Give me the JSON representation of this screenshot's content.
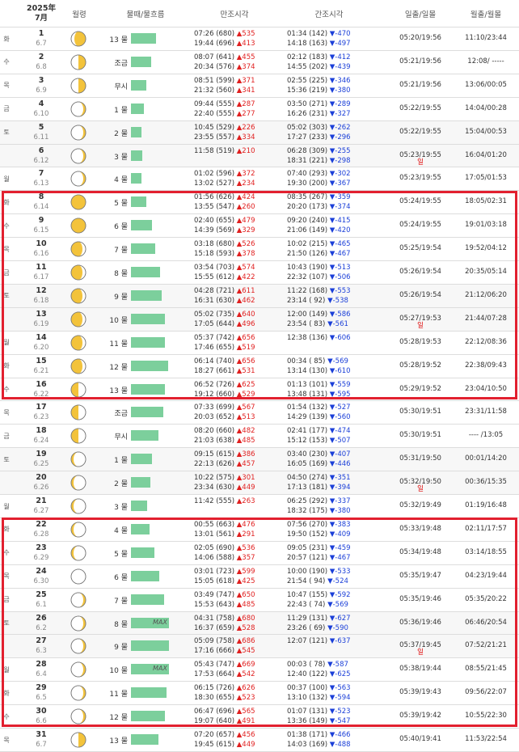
{
  "header": {
    "year_month_line1": "2025年",
    "year_month_line2": "7月",
    "moon_phase": "월령",
    "tide_flow": "물때/물흐름",
    "high_tide": "만조시각",
    "low_tide": "간조시각",
    "sunrise_sunset": "일출/일몰",
    "moonrise_moonset": "월출/월몰"
  },
  "colors": {
    "bar": "#7ccf9c",
    "up": "#e02020",
    "down": "#1b3fd8",
    "highlight_box": "#e2202f"
  },
  "rows": [
    {
      "dow": "화",
      "d": "1",
      "lunar": "6.7",
      "moon": "waxing-gibbous",
      "tide": "13 물",
      "bar": 0.52,
      "max": "",
      "h1": "07:26 (680) ",
      "h1d": "▲535",
      "h2": "19:44 (696) ",
      "h2d": "▲413",
      "l1": "01:34 (142) ",
      "l1d": "▼-470",
      "l2": "14:18 (163) ",
      "l2d": "▼-497",
      "sun": "05:20/19:56",
      "moonrs": "11:10/23:44"
    },
    {
      "dow": "수",
      "d": "2",
      "lunar": "6.8",
      "moon": "first-quarter",
      "tide": "조금",
      "bar": 0.42,
      "max": "",
      "h1": "08:07 (641) ",
      "h1d": "▲455",
      "h2": "20:34 (576) ",
      "h2d": "▲374",
      "l1": "02:12 (183) ",
      "l1d": "▼-412",
      "l2": "14:55 (202) ",
      "l2d": "▼-439",
      "sun": "05:21/19:56",
      "moonrs": "12:08/  -----"
    },
    {
      "dow": "목",
      "d": "3",
      "lunar": "6.9",
      "moon": "first-quarter",
      "tide": "무시",
      "bar": 0.32,
      "max": "",
      "h1": "08:51 (599) ",
      "h1d": "▲371",
      "h2": "21:32 (560) ",
      "h2d": "▲341",
      "l1": "02:55 (225) ",
      "l1d": "▼-346",
      "l2": "15:36 (219) ",
      "l2d": "▼-380",
      "sun": "05:21/19:56",
      "moonrs": "13:06/00:05"
    },
    {
      "dow": "금",
      "d": "4",
      "lunar": "6.10",
      "moon": "waxing-crescent",
      "tide": "1 물",
      "bar": 0.26,
      "max": "",
      "h1": "09:44 (555) ",
      "h1d": "▲287",
      "h2": "22:40 (555) ",
      "h2d": "▲277",
      "l1": "03:50 (271) ",
      "l1d": "▼-289",
      "l2": "16:26 (231) ",
      "l2d": "▼-327",
      "sun": "05:22/19:55",
      "moonrs": "14:04/00:28"
    },
    {
      "dow": "토",
      "d": "5",
      "lunar": "6.11",
      "moon": "waxing-crescent",
      "tide": "2 물",
      "bar": 0.22,
      "max": "",
      "h1": "10:45 (529) ",
      "h1d": "▲226",
      "h2": "23:55 (557) ",
      "h2d": "▲334",
      "l1": "05:02 (303) ",
      "l1d": "▼-262",
      "l2": "17:27 (233) ",
      "l2d": "▼-296",
      "sun": "05:22/19:55",
      "moonrs": "15:04/00:53"
    },
    {
      "dow": "일",
      "d": "6",
      "lunar": "6.12",
      "moon": "waxing-crescent",
      "tide": "3 물",
      "bar": 0.23,
      "max": "",
      "h1": "11:58 (519) ",
      "h1d": "▲210",
      "h2": "",
      "h2d": "",
      "l1": "06:28 (309) ",
      "l1d": "▼-255",
      "l2": "18:31 (221) ",
      "l2d": "▼-298",
      "sun": "05:23/19:55",
      "moonrs": "16:04/01:20"
    },
    {
      "dow": "월",
      "d": "7",
      "lunar": "6.13",
      "moon": "waxing-crescent",
      "tide": "4 물",
      "bar": 0.22,
      "max": "",
      "h1": "01:02 (596) ",
      "h1d": "▲372",
      "h2": "13:02 (527) ",
      "h2d": "▲234",
      "l1": "07:40 (293) ",
      "l1d": "▼-302",
      "l2": "19:30 (200) ",
      "l2d": "▼-367",
      "sun": "05:23/19:55",
      "moonrs": "17:05/01:53"
    },
    {
      "dow": "화",
      "d": "8",
      "lunar": "6.14",
      "moon": "full",
      "tide": "5 물",
      "bar": 0.32,
      "max": "",
      "h1": "01:56 (626) ",
      "h1d": "▲424",
      "h2": "13:55 (547) ",
      "h2d": "▲260",
      "l1": "08:35 (267) ",
      "l1d": "▼-359",
      "l2": "20:20 (173) ",
      "l2d": "▼-374",
      "sun": "05:24/19:55",
      "moonrs": "18:05/02:31"
    },
    {
      "dow": "수",
      "d": "9",
      "lunar": "6.15",
      "moon": "full",
      "tide": "6 물",
      "bar": 0.44,
      "max": "",
      "h1": "02:40 (655) ",
      "h1d": "▲479",
      "h2": "14:39 (569) ",
      "h2d": "▲329",
      "l1": "09:20 (240) ",
      "l1d": "▼-415",
      "l2": "21:06 (149) ",
      "l2d": "▼-420",
      "sun": "05:24/19:55",
      "moonrs": "19:01/03:18"
    },
    {
      "dow": "목",
      "d": "10",
      "lunar": "6.16",
      "moon": "waning-gibbous",
      "tide": "7 물",
      "bar": 0.5,
      "max": "",
      "h1": "03:18 (680) ",
      "h1d": "▲526",
      "h2": "15:18 (593) ",
      "h2d": "▲378",
      "l1": "10:02 (215) ",
      "l1d": "▼-465",
      "l2": "21:50 (126) ",
      "l2d": "▼-467",
      "sun": "05:25/19:54",
      "moonrs": "19:52/04:12"
    },
    {
      "dow": "금",
      "d": "11",
      "lunar": "6.17",
      "moon": "waning-gibbous",
      "tide": "8 물",
      "bar": 0.6,
      "max": "",
      "h1": "03:54 (703) ",
      "h1d": "▲574",
      "h2": "15:55 (612) ",
      "h2d": "▲422",
      "l1": "10:43 (190) ",
      "l1d": "▼-513",
      "l2": "22:32 (107) ",
      "l2d": "▼-506",
      "sun": "05:26/19:54",
      "moonrs": "20:35/05:14"
    },
    {
      "dow": "토",
      "d": "12",
      "lunar": "6.18",
      "moon": "waning-gibbous",
      "tide": "9 물",
      "bar": 0.64,
      "max": "",
      "h1": "04:28 (721) ",
      "h1d": "▲611",
      "h2": "16:31 (630) ",
      "h2d": "▲462",
      "l1": "11:22 (168) ",
      "l1d": "▼-553",
      "l2": "23:14 ( 92) ",
      "l2d": "▼-538",
      "sun": "05:26/19:54",
      "moonrs": "21:12/06:20"
    },
    {
      "dow": "일",
      "d": "13",
      "lunar": "6.19",
      "moon": "waning-gibbous",
      "tide": "10 물",
      "bar": 0.7,
      "max": "",
      "h1": "05:02 (735) ",
      "h1d": "▲640",
      "h2": "17:05 (644) ",
      "h2d": "▲496",
      "l1": "12:00 (149) ",
      "l1d": "▼-586",
      "l2": "23:54 ( 83) ",
      "l2d": "▼-561",
      "sun": "05:27/19:53",
      "moonrs": "21:44/07:28"
    },
    {
      "dow": "월",
      "d": "14",
      "lunar": "6.20",
      "moon": "waning-gibbous",
      "tide": "11 물",
      "bar": 0.7,
      "max": "",
      "h1": "05:37 (742) ",
      "h1d": "▲656",
      "h2": "17:46 (655) ",
      "h2d": "▲519",
      "l1": "12:38 (136) ",
      "l1d": "▼-606",
      "l2": "",
      "l2d": "",
      "sun": "05:28/19:53",
      "moonrs": "22:12/08:36"
    },
    {
      "dow": "화",
      "d": "15",
      "lunar": "6.21",
      "moon": "waning-gibbous",
      "tide": "12 물",
      "bar": 0.76,
      "max": "",
      "h1": "06:14 (740) ",
      "h1d": "▲656",
      "h2": "18:27 (661) ",
      "h2d": "▲531",
      "l1": "00:34 ( 85) ",
      "l1d": "▼-569",
      "l2": "13:14 (130) ",
      "l2d": "▼-610",
      "sun": "05:28/19:52",
      "moonrs": "22:38/09:43"
    },
    {
      "dow": "수",
      "d": "16",
      "lunar": "6.22",
      "moon": "third-quarter",
      "tide": "13 물",
      "bar": 0.7,
      "max": "",
      "h1": "06:52 (726) ",
      "h1d": "▲625",
      "h2": "19:12 (660) ",
      "h2d": "▲529",
      "l1": "01:13 (101) ",
      "l1d": "▼-559",
      "l2": "13:48 (131) ",
      "l2d": "▼-595",
      "sun": "05:29/19:52",
      "moonrs": "23:04/10:50"
    },
    {
      "dow": "목",
      "d": "17",
      "lunar": "6.23",
      "moon": "third-quarter",
      "tide": "조금",
      "bar": 0.66,
      "max": "",
      "h1": "07:33 (699) ",
      "h1d": "▲567",
      "h2": "20:03 (652) ",
      "h2d": "▲513",
      "l1": "01:54 (132) ",
      "l1d": "▼-527",
      "l2": "14:29 (139) ",
      "l2d": "▼-560",
      "sun": "05:30/19:51",
      "moonrs": "23:31/11:58"
    },
    {
      "dow": "금",
      "d": "18",
      "lunar": "6.24",
      "moon": "third-quarter",
      "tide": "무시",
      "bar": 0.56,
      "max": "",
      "h1": "08:20 (660) ",
      "h1d": "▲482",
      "h2": "21:03 (638) ",
      "h2d": "▲485",
      "l1": "02:41 (177) ",
      "l1d": "▼-474",
      "l2": "15:12 (153) ",
      "l2d": "▼-507",
      "sun": "05:30/19:51",
      "moonrs": "----  /13:05"
    },
    {
      "dow": "토",
      "d": "19",
      "lunar": "6.25",
      "moon": "waning-crescent",
      "tide": "1 물",
      "bar": 0.44,
      "max": "",
      "h1": "09:15 (615) ",
      "h1d": "▲386",
      "h2": "22:13 (626) ",
      "h2d": "▲457",
      "l1": "03:40 (230) ",
      "l1d": "▼-407",
      "l2": "16:05 (169) ",
      "l2d": "▼-446",
      "sun": "05:31/19:50",
      "moonrs": "00:01/14:20"
    },
    {
      "dow": "일",
      "d": "20",
      "lunar": "6.26",
      "moon": "waning-crescent",
      "tide": "2 물",
      "bar": 0.4,
      "max": "",
      "h1": "10:22 (575) ",
      "h1d": "▲301",
      "h2": "23:34 (630) ",
      "h2d": "▲449",
      "l1": "04:50 (274) ",
      "l1d": "▼-351",
      "l2": "17:13 (181) ",
      "l2d": "▼-394",
      "sun": "05:32/19:50",
      "moonrs": "00:36/15:35"
    },
    {
      "dow": "월",
      "d": "21",
      "lunar": "6.27",
      "moon": "waning-crescent",
      "tide": "3 물",
      "bar": 0.34,
      "max": "",
      "h1": "11:42 (555) ",
      "h1d": "▲263",
      "h2": "",
      "h2d": "",
      "l1": "06:25 (292) ",
      "l1d": "▼-337",
      "l2": "18:32 (175) ",
      "l2d": "▼-380",
      "sun": "05:32/19:49",
      "moonrs": "01:19/16:48"
    },
    {
      "dow": "화",
      "d": "22",
      "lunar": "6.28",
      "moon": "waning-crescent",
      "tide": "4 물",
      "bar": 0.38,
      "max": "",
      "h1": "00:55 (663) ",
      "h1d": "▲476",
      "h2": "13:01 (561) ",
      "h2d": "▲291",
      "l1": "07:56 (270) ",
      "l1d": "▼-383",
      "l2": "19:50 (152) ",
      "l2d": "▼-409",
      "sun": "05:33/19:48",
      "moonrs": "02:11/17:57"
    },
    {
      "dow": "수",
      "d": "23",
      "lunar": "6.29",
      "moon": "waning-crescent",
      "tide": "5 물",
      "bar": 0.48,
      "max": "",
      "h1": "02:05 (690) ",
      "h1d": "▲536",
      "h2": "14:06 (588) ",
      "h2d": "▲357",
      "l1": "09:05 (231) ",
      "l1d": "▼-459",
      "l2": "20:57 (121) ",
      "l2d": "▼-467",
      "sun": "05:34/19:48",
      "moonrs": "03:14/18:55"
    },
    {
      "dow": "목",
      "d": "24",
      "lunar": "6.30",
      "moon": "new",
      "tide": "6 물",
      "bar": 0.58,
      "max": "",
      "h1": "03:01 (723) ",
      "h1d": "▲599",
      "h2": "15:05 (618) ",
      "h2d": "▲425",
      "l1": "10:00 (190) ",
      "l1d": "▼-533",
      "l2": "21:54 ( 94) ",
      "l2d": "▼-524",
      "sun": "05:35/19:47",
      "moonrs": "04:23/19:44"
    },
    {
      "dow": "금",
      "d": "25",
      "lunar": "6.1",
      "moon": "waxing-crescent",
      "tide": "7 물",
      "bar": 0.68,
      "max": "",
      "h1": "03:49 (747) ",
      "h1d": "▲650",
      "h2": "15:53 (643) ",
      "h2d": "▲485",
      "l1": "10:47 (155) ",
      "l1d": "▼-592",
      "l2": "22:43 ( 74) ",
      "l2d": "▼-569",
      "sun": "05:35/19:46",
      "moonrs": "05:35/20:22"
    },
    {
      "dow": "토",
      "d": "26",
      "lunar": "6.2",
      "moon": "waxing-crescent",
      "tide": "8 물",
      "bar": 0.78,
      "max": "MAX",
      "h1": "04:31 (758) ",
      "h1d": "▲680",
      "h2": "16:37 (659) ",
      "h2d": "▲528",
      "l1": "11:29 (131) ",
      "l1d": "▼-627",
      "l2": "23:26 ( 69) ",
      "l2d": "▼-590",
      "sun": "05:36/19:46",
      "moonrs": "06:46/20:54"
    },
    {
      "dow": "일",
      "d": "27",
      "lunar": "6.3",
      "moon": "waxing-crescent",
      "tide": "9 물",
      "bar": 0.78,
      "max": "",
      "h1": "05:09 (758) ",
      "h1d": "▲686",
      "h2": "17:16 (666) ",
      "h2d": "▲545",
      "l1": "12:07 (121) ",
      "l1d": "▼-637",
      "l2": "",
      "l2d": "",
      "sun": "05:37/19:45",
      "moonrs": "07:52/21:21"
    },
    {
      "dow": "월",
      "d": "28",
      "lunar": "6.4",
      "moon": "waxing-crescent",
      "tide": "10 물",
      "bar": 0.78,
      "max": "MAX",
      "h1": "05:43 (747) ",
      "h1d": "▲669",
      "h2": "17:53 (664) ",
      "h2d": "▲542",
      "l1": "00:03 ( 78) ",
      "l1d": "▼-587",
      "l2": "12:40 (122) ",
      "l2d": "▼-625",
      "sun": "05:38/19:44",
      "moonrs": "08:55/21:45"
    },
    {
      "dow": "화",
      "d": "29",
      "lunar": "6.5",
      "moon": "waxing-crescent",
      "tide": "11 물",
      "bar": 0.74,
      "max": "",
      "h1": "06:15 (726) ",
      "h1d": "▲626",
      "h2": "18:30 (655) ",
      "h2d": "▲523",
      "l1": "00:37 (100) ",
      "l1d": "▼-563",
      "l2": "13:10 (132) ",
      "l2d": "▼-594",
      "sun": "05:39/19:43",
      "moonrs": "09:56/22:07"
    },
    {
      "dow": "수",
      "d": "30",
      "lunar": "6.6",
      "moon": "waxing-crescent",
      "tide": "12 물",
      "bar": 0.7,
      "max": "",
      "h1": "06:47 (696) ",
      "h1d": "▲565",
      "h2": "19:07 (640) ",
      "h2d": "▲491",
      "l1": "01:07 (131) ",
      "l1d": "▼-523",
      "l2": "13:36 (149) ",
      "l2d": "▼-547",
      "sun": "05:39/19:42",
      "moonrs": "10:55/22:30"
    },
    {
      "dow": "목",
      "d": "31",
      "lunar": "6.7",
      "moon": "first-quarter",
      "tide": "13 물",
      "bar": 0.56,
      "max": "",
      "h1": "07:20 (657) ",
      "h1d": "▲456",
      "h2": "19:45 (615) ",
      "h2d": "▲449",
      "l1": "01:38 (171) ",
      "l1d": "▼-466",
      "l2": "14:03 (169) ",
      "l2d": "▼-488",
      "sun": "05:40/19:41",
      "moonrs": "11:53/22:54"
    }
  ]
}
